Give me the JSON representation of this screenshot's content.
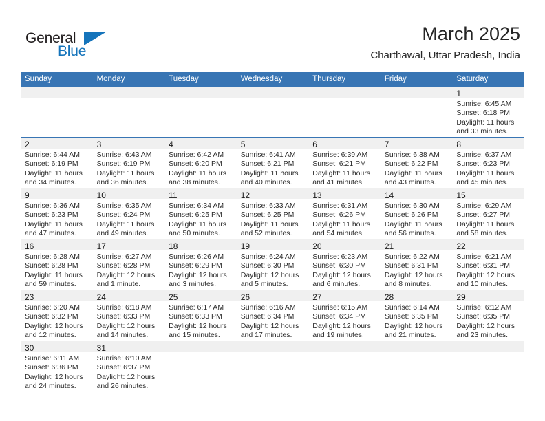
{
  "brand": {
    "name_top": "General",
    "name_bottom": "Blue",
    "accent_color": "#1574bb"
  },
  "header": {
    "title": "March 2025",
    "subtitle": "Charthawal, Uttar Pradesh, India"
  },
  "theme": {
    "header_row_background": "#3875b4",
    "header_row_text": "#ffffff",
    "daynum_background": "#f0f0f0",
    "grid_line": "#3875b4",
    "body_text": "#2b2b2b"
  },
  "labels": {
    "sunrise_prefix": "Sunrise: ",
    "sunset_prefix": "Sunset: ",
    "daylight_prefix": "Daylight: "
  },
  "weekday_headers": [
    "Sunday",
    "Monday",
    "Tuesday",
    "Wednesday",
    "Thursday",
    "Friday",
    "Saturday"
  ],
  "weeks": [
    [
      {
        "empty": true
      },
      {
        "empty": true
      },
      {
        "empty": true
      },
      {
        "empty": true
      },
      {
        "empty": true
      },
      {
        "empty": true
      },
      {
        "day": "1",
        "sunrise": "Sunrise: 6:45 AM",
        "sunset": "Sunset: 6:18 PM",
        "daylight": "Daylight: 11 hours and 33 minutes."
      }
    ],
    [
      {
        "day": "2",
        "sunrise": "Sunrise: 6:44 AM",
        "sunset": "Sunset: 6:19 PM",
        "daylight": "Daylight: 11 hours and 34 minutes."
      },
      {
        "day": "3",
        "sunrise": "Sunrise: 6:43 AM",
        "sunset": "Sunset: 6:19 PM",
        "daylight": "Daylight: 11 hours and 36 minutes."
      },
      {
        "day": "4",
        "sunrise": "Sunrise: 6:42 AM",
        "sunset": "Sunset: 6:20 PM",
        "daylight": "Daylight: 11 hours and 38 minutes."
      },
      {
        "day": "5",
        "sunrise": "Sunrise: 6:41 AM",
        "sunset": "Sunset: 6:21 PM",
        "daylight": "Daylight: 11 hours and 40 minutes."
      },
      {
        "day": "6",
        "sunrise": "Sunrise: 6:39 AM",
        "sunset": "Sunset: 6:21 PM",
        "daylight": "Daylight: 11 hours and 41 minutes."
      },
      {
        "day": "7",
        "sunrise": "Sunrise: 6:38 AM",
        "sunset": "Sunset: 6:22 PM",
        "daylight": "Daylight: 11 hours and 43 minutes."
      },
      {
        "day": "8",
        "sunrise": "Sunrise: 6:37 AM",
        "sunset": "Sunset: 6:23 PM",
        "daylight": "Daylight: 11 hours and 45 minutes."
      }
    ],
    [
      {
        "day": "9",
        "sunrise": "Sunrise: 6:36 AM",
        "sunset": "Sunset: 6:23 PM",
        "daylight": "Daylight: 11 hours and 47 minutes."
      },
      {
        "day": "10",
        "sunrise": "Sunrise: 6:35 AM",
        "sunset": "Sunset: 6:24 PM",
        "daylight": "Daylight: 11 hours and 49 minutes."
      },
      {
        "day": "11",
        "sunrise": "Sunrise: 6:34 AM",
        "sunset": "Sunset: 6:25 PM",
        "daylight": "Daylight: 11 hours and 50 minutes."
      },
      {
        "day": "12",
        "sunrise": "Sunrise: 6:33 AM",
        "sunset": "Sunset: 6:25 PM",
        "daylight": "Daylight: 11 hours and 52 minutes."
      },
      {
        "day": "13",
        "sunrise": "Sunrise: 6:31 AM",
        "sunset": "Sunset: 6:26 PM",
        "daylight": "Daylight: 11 hours and 54 minutes."
      },
      {
        "day": "14",
        "sunrise": "Sunrise: 6:30 AM",
        "sunset": "Sunset: 6:26 PM",
        "daylight": "Daylight: 11 hours and 56 minutes."
      },
      {
        "day": "15",
        "sunrise": "Sunrise: 6:29 AM",
        "sunset": "Sunset: 6:27 PM",
        "daylight": "Daylight: 11 hours and 58 minutes."
      }
    ],
    [
      {
        "day": "16",
        "sunrise": "Sunrise: 6:28 AM",
        "sunset": "Sunset: 6:28 PM",
        "daylight": "Daylight: 11 hours and 59 minutes."
      },
      {
        "day": "17",
        "sunrise": "Sunrise: 6:27 AM",
        "sunset": "Sunset: 6:28 PM",
        "daylight": "Daylight: 12 hours and 1 minute."
      },
      {
        "day": "18",
        "sunrise": "Sunrise: 6:26 AM",
        "sunset": "Sunset: 6:29 PM",
        "daylight": "Daylight: 12 hours and 3 minutes."
      },
      {
        "day": "19",
        "sunrise": "Sunrise: 6:24 AM",
        "sunset": "Sunset: 6:30 PM",
        "daylight": "Daylight: 12 hours and 5 minutes."
      },
      {
        "day": "20",
        "sunrise": "Sunrise: 6:23 AM",
        "sunset": "Sunset: 6:30 PM",
        "daylight": "Daylight: 12 hours and 6 minutes."
      },
      {
        "day": "21",
        "sunrise": "Sunrise: 6:22 AM",
        "sunset": "Sunset: 6:31 PM",
        "daylight": "Daylight: 12 hours and 8 minutes."
      },
      {
        "day": "22",
        "sunrise": "Sunrise: 6:21 AM",
        "sunset": "Sunset: 6:31 PM",
        "daylight": "Daylight: 12 hours and 10 minutes."
      }
    ],
    [
      {
        "day": "23",
        "sunrise": "Sunrise: 6:20 AM",
        "sunset": "Sunset: 6:32 PM",
        "daylight": "Daylight: 12 hours and 12 minutes."
      },
      {
        "day": "24",
        "sunrise": "Sunrise: 6:18 AM",
        "sunset": "Sunset: 6:33 PM",
        "daylight": "Daylight: 12 hours and 14 minutes."
      },
      {
        "day": "25",
        "sunrise": "Sunrise: 6:17 AM",
        "sunset": "Sunset: 6:33 PM",
        "daylight": "Daylight: 12 hours and 15 minutes."
      },
      {
        "day": "26",
        "sunrise": "Sunrise: 6:16 AM",
        "sunset": "Sunset: 6:34 PM",
        "daylight": "Daylight: 12 hours and 17 minutes."
      },
      {
        "day": "27",
        "sunrise": "Sunrise: 6:15 AM",
        "sunset": "Sunset: 6:34 PM",
        "daylight": "Daylight: 12 hours and 19 minutes."
      },
      {
        "day": "28",
        "sunrise": "Sunrise: 6:14 AM",
        "sunset": "Sunset: 6:35 PM",
        "daylight": "Daylight: 12 hours and 21 minutes."
      },
      {
        "day": "29",
        "sunrise": "Sunrise: 6:12 AM",
        "sunset": "Sunset: 6:35 PM",
        "daylight": "Daylight: 12 hours and 23 minutes."
      }
    ],
    [
      {
        "day": "30",
        "sunrise": "Sunrise: 6:11 AM",
        "sunset": "Sunset: 6:36 PM",
        "daylight": "Daylight: 12 hours and 24 minutes."
      },
      {
        "day": "31",
        "sunrise": "Sunrise: 6:10 AM",
        "sunset": "Sunset: 6:37 PM",
        "daylight": "Daylight: 12 hours and 26 minutes."
      },
      {
        "empty": true
      },
      {
        "empty": true
      },
      {
        "empty": true
      },
      {
        "empty": true
      },
      {
        "empty": true
      }
    ]
  ]
}
